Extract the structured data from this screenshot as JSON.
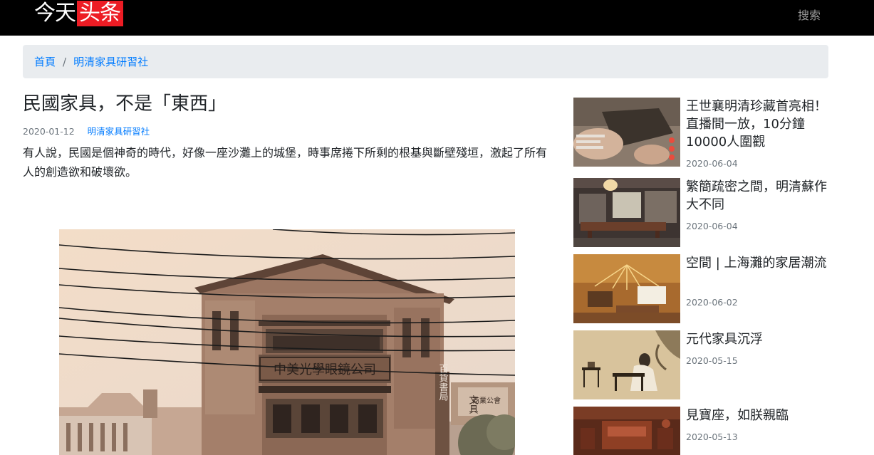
{
  "navbar": {
    "brand_part1": "今天",
    "brand_part2": "头条",
    "search_label": "搜索"
  },
  "breadcrumb": {
    "home": "首頁",
    "separator": "/",
    "category": "明清家具研習社"
  },
  "article": {
    "title": "民國家具，不是「東西」",
    "date": "2020-01-12",
    "category": "明清家具研習社",
    "lead": "有人說，民國是個神奇的時代，好像一座沙灘上的城堡，時事席捲下所剩的根基與斷壁殘垣，激起了所有人的創造欲和破壞欲。",
    "photo_sign": "中美光學眼鏡公司",
    "photo_side_sign": "百貨書局",
    "photo_right_sign": "文具",
    "photo_shop_sign": "商業公會"
  },
  "sidebar": {
    "items": [
      {
        "title": "王世襄明清珍藏首亮相！直播間一放，10分鐘10000人圍觀",
        "date": "2020-06-04"
      },
      {
        "title": "繁簡疏密之間，明清蘇作大不同",
        "date": "2020-06-04"
      },
      {
        "title": "空間 | 上海灘的家居潮流",
        "date": "2020-06-02"
      },
      {
        "title": "元代家具沉浮",
        "date": "2020-05-15"
      },
      {
        "title": "見寶座，如朕親臨",
        "date": "2020-05-13"
      }
    ]
  },
  "colors": {
    "brand_red": "#ed1c24",
    "link_blue": "#007bff",
    "muted": "#6c757d",
    "breadcrumb_bg": "#e9ecef"
  }
}
